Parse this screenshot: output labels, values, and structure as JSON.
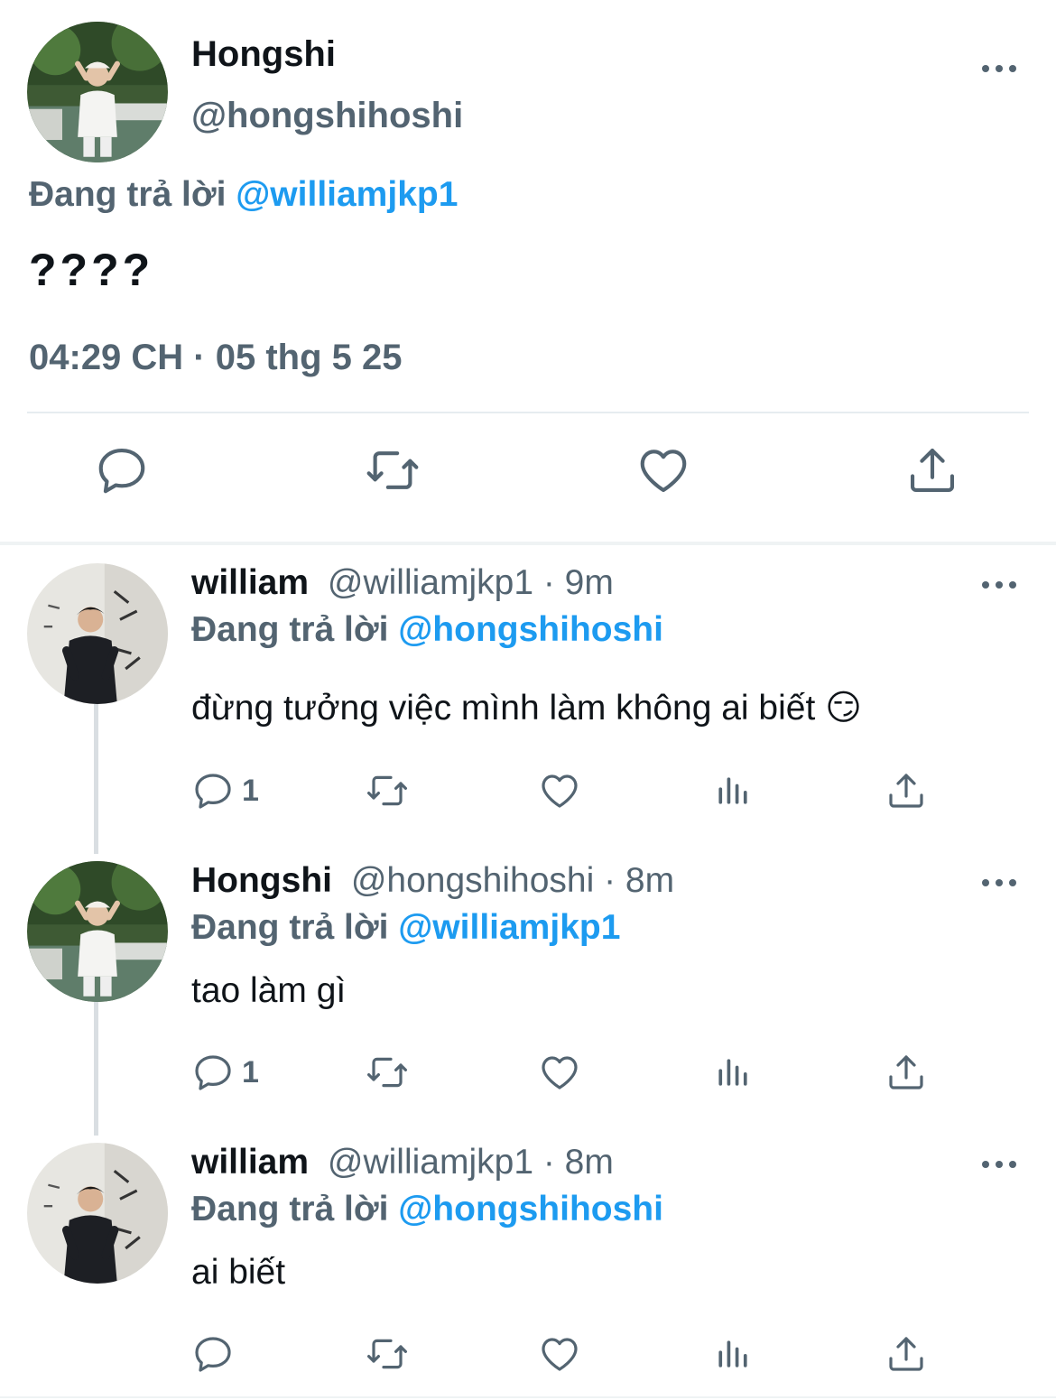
{
  "main": {
    "display_name": "Hongshi",
    "handle": "@hongshihoshi",
    "replying_prefix": "Đang trả lời",
    "replying_to": "@williamjkp1",
    "text": "????",
    "timestamp": "04:29 CH · 05 thg 5 25",
    "actions": [
      "reply-icon",
      "retweet-icon",
      "like-icon",
      "share-icon"
    ]
  },
  "replies": [
    {
      "display_name": "william",
      "handle_time": "@williamjkp1 · 9m",
      "replying_prefix": "Đang trả lời",
      "replying_to": "@hongshihoshi",
      "text": "đừng tưởng việc mình làm không ai biết 😏",
      "reply_count": "1"
    },
    {
      "display_name": "Hongshi",
      "handle_time": "@hongshihoshi · 8m",
      "replying_prefix": "Đang trả lời",
      "replying_to": "@williamjkp1",
      "text": "tao làm gì",
      "reply_count": "1"
    },
    {
      "display_name": "william",
      "handle_time": "@williamjkp1 · 8m",
      "replying_prefix": "Đang trả lời",
      "replying_to": "@hongshihoshi",
      "text": "ai biết",
      "reply_count": ""
    }
  ],
  "colors": {
    "text": "#0f1419",
    "secondary": "#536471",
    "link": "#1d9bf0",
    "divider": "#eff3f4",
    "thread_line": "#d9dee2"
  }
}
